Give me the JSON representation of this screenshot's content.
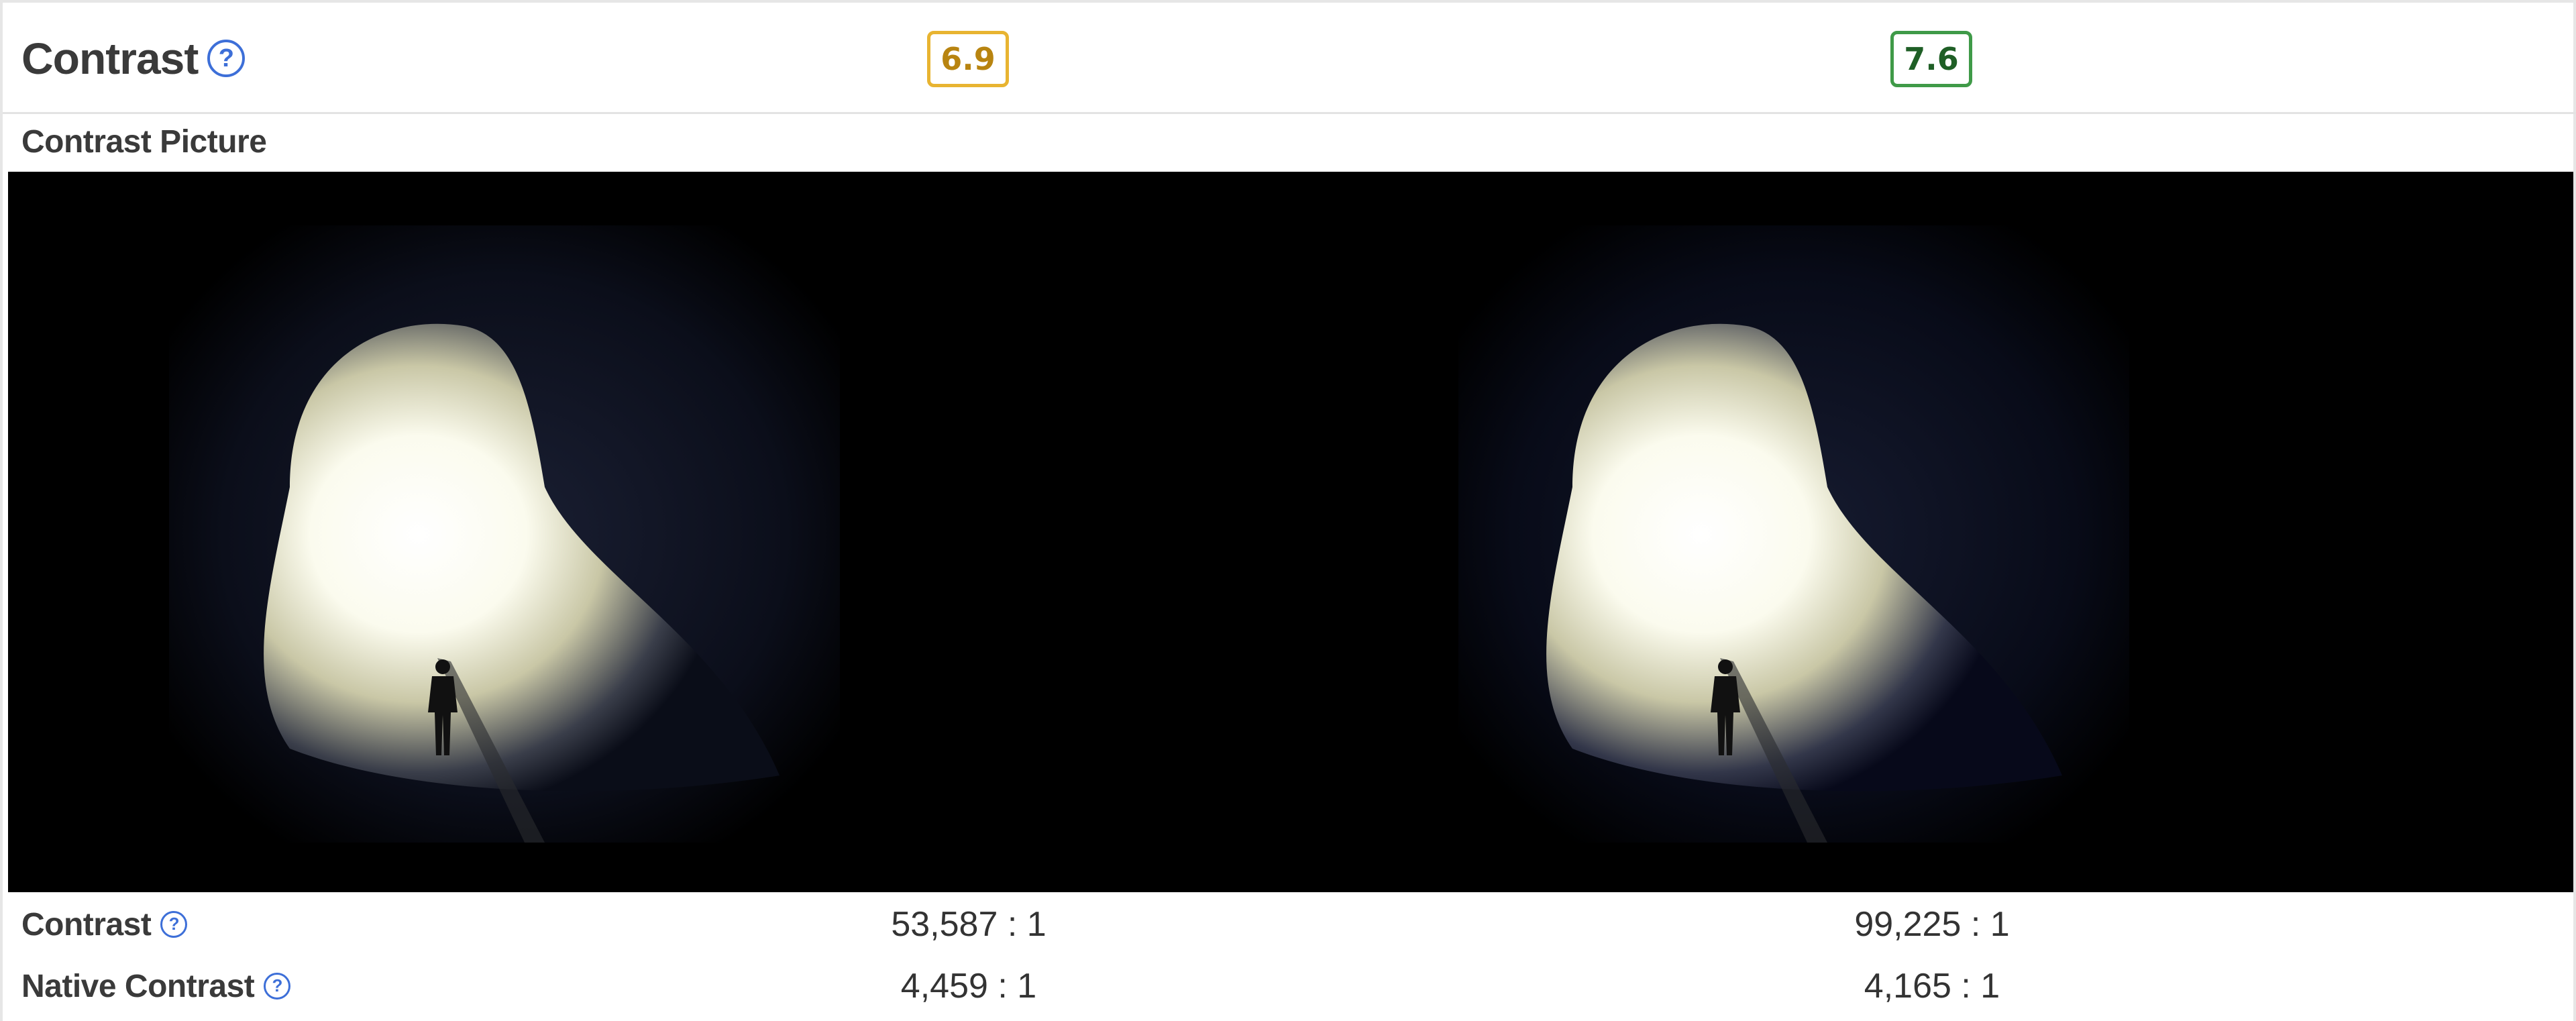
{
  "section": {
    "title": "Contrast",
    "scores": {
      "left": "6.9",
      "right": "7.6"
    },
    "colors": {
      "score_left": "#e8b431",
      "score_right": "#3f9a48",
      "help_icon": "#3d6fd8"
    }
  },
  "picture": {
    "label": "Contrast Picture",
    "help_glyph": "?"
  },
  "metrics": [
    {
      "label": "Contrast",
      "left": "53,587 : 1",
      "right": "99,225 : 1"
    },
    {
      "label": "Native Contrast",
      "left": "4,459 : 1",
      "right": "4,165 : 1"
    }
  ]
}
